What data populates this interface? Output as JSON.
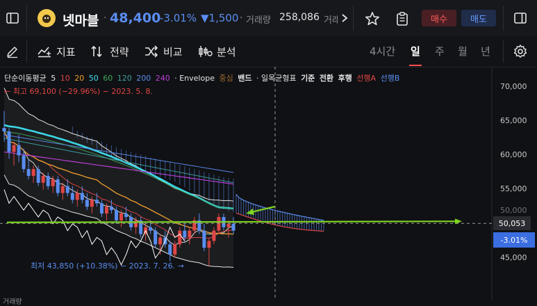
{
  "header": {
    "stock_name": "넷마블",
    "price": "48,400",
    "change_pct": "-3.01%",
    "change_abs": "▼1,500",
    "volume_label": "거래량",
    "volume_value": "258,086",
    "volume_label_cut": "거래",
    "buy_label": "매수",
    "sell_label": "매도"
  },
  "toolbar": {
    "indicators_label": "지표",
    "strategy_label": "전략",
    "compare_label": "비교",
    "analysis_label": "분석",
    "periods": [
      "4시간",
      "일",
      "주",
      "월",
      "년"
    ],
    "active_period": "일"
  },
  "legend": {
    "sma_label": "단순이동평균",
    "sma_periods": [
      {
        "label": "5",
        "color": "#e6e6e6"
      },
      {
        "label": "10",
        "color": "#e04646"
      },
      {
        "label": "20",
        "color": "#f0a030"
      },
      {
        "label": "50",
        "color": "#3ee0f0"
      },
      {
        "label": "60",
        "color": "#3ea860"
      },
      {
        "label": "120",
        "color": "#3ea0a0"
      },
      {
        "label": "200",
        "color": "#5a8df0"
      },
      {
        "label": "240",
        "color": "#c040e0"
      }
    ],
    "envelope_label": "· Envelope",
    "envelope_middle": "중심",
    "band_label": "밴드",
    "ichimoku_label": "· 일목균형표",
    "ichimoku_items": [
      "기준",
      "전환",
      "후행"
    ],
    "span_a": "선행A",
    "span_b": "선행B"
  },
  "annotations": {
    "max": "← 최고 69,100 (−29.96%) − 2023. 5. 8.",
    "min": "최저 43,850 (+10.38%) − 2023. 7. 26. →"
  },
  "y_axis": {
    "ticks": [
      "70,000",
      "65,000",
      "60,000",
      "55,000",
      "50,000",
      "45,000"
    ],
    "current_price": "50,053",
    "current_pct": "-3.01%"
  },
  "footer": {
    "text": "거래량"
  },
  "colors": {
    "down": "#5a8df0",
    "up": "#e04646",
    "buy_bg": "#4a1f24",
    "sell_bg": "#1f2c4a",
    "horizontal_line": "#7ed321",
    "span_a": "#e04646",
    "span_b": "#5a8df0"
  },
  "chart_data": {
    "type": "line",
    "ylim": [
      42000,
      72500
    ],
    "yticks": [
      70000,
      65000,
      60000,
      55000,
      50000,
      45000
    ],
    "current_price": 50053,
    "horizontal_level": 50053,
    "high": {
      "value": 69100,
      "date": "2023. 5. 8.",
      "pct": "-29.96%"
    },
    "low": {
      "value": 43850,
      "date": "2023. 7. 26.",
      "pct": "+10.38%"
    },
    "candles": [
      [
        64000,
        66500,
        62000,
        63500
      ],
      [
        63500,
        64000,
        59500,
        60500
      ],
      [
        60500,
        62000,
        58500,
        61500
      ],
      [
        61500,
        63000,
        59000,
        60000
      ],
      [
        60000,
        61000,
        57500,
        58000
      ],
      [
        58000,
        59500,
        56500,
        57000
      ],
      [
        57000,
        58500,
        56000,
        58000
      ],
      [
        58000,
        58500,
        55500,
        56000
      ],
      [
        56000,
        57500,
        55000,
        57000
      ],
      [
        57000,
        57500,
        55000,
        55500
      ],
      [
        55500,
        57000,
        54500,
        56500
      ],
      [
        56500,
        57000,
        54000,
        54500
      ],
      [
        54500,
        56000,
        53500,
        55500
      ],
      [
        55500,
        56500,
        54000,
        54500
      ],
      [
        54500,
        55500,
        53000,
        53500
      ],
      [
        53500,
        55000,
        52500,
        54500
      ],
      [
        54500,
        55500,
        53000,
        53500
      ],
      [
        53500,
        54500,
        52000,
        52500
      ],
      [
        52500,
        54000,
        51500,
        53500
      ],
      [
        53500,
        54500,
        52500,
        53000
      ],
      [
        53000,
        53500,
        51000,
        51500
      ],
      [
        51500,
        53000,
        50500,
        52500
      ],
      [
        52500,
        53500,
        51500,
        52000
      ],
      [
        52000,
        52500,
        50000,
        50500
      ],
      [
        50500,
        52000,
        49500,
        51500
      ],
      [
        51500,
        52500,
        50500,
        51000
      ],
      [
        51000,
        51500,
        49000,
        49500
      ],
      [
        49500,
        51000,
        48500,
        50500
      ],
      [
        50500,
        51000,
        48000,
        48500
      ],
      [
        48500,
        50000,
        47500,
        49500
      ],
      [
        49500,
        50500,
        48500,
        49000
      ],
      [
        49000,
        49500,
        46500,
        47000
      ],
      [
        47000,
        48500,
        45500,
        48000
      ],
      [
        48000,
        49000,
        46500,
        47000
      ],
      [
        47000,
        47500,
        44500,
        45500
      ],
      [
        45500,
        47500,
        45000,
        47000
      ],
      [
        47000,
        49500,
        46500,
        49000
      ],
      [
        49000,
        50000,
        47500,
        48000
      ],
      [
        48000,
        49500,
        47000,
        49000
      ],
      [
        49000,
        51000,
        48500,
        50500
      ],
      [
        50500,
        51500,
        48500,
        49000
      ],
      [
        49000,
        50000,
        46000,
        46500
      ],
      [
        46500,
        48000,
        43850,
        47500
      ],
      [
        47500,
        49500,
        47000,
        49000
      ],
      [
        49000,
        51500,
        48500,
        51000
      ],
      [
        51000,
        51500,
        49000,
        49500
      ],
      [
        49500,
        50500,
        48000,
        50000
      ],
      [
        50000,
        51000,
        48500,
        49000
      ]
    ],
    "forecast_span_a_end": 49000,
    "forecast_span_b_end": 50500
  }
}
